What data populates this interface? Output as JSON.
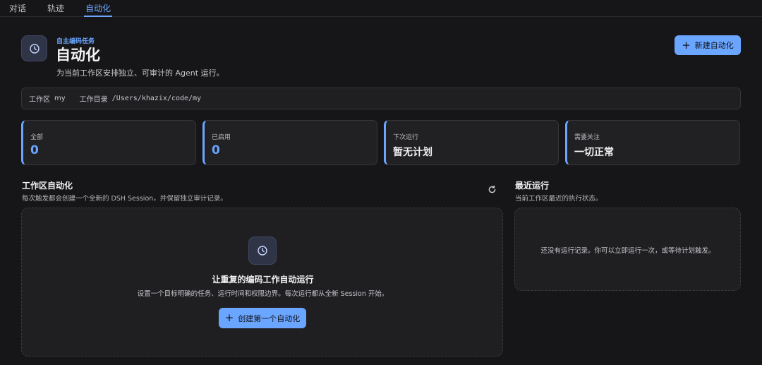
{
  "tabs": [
    {
      "label": "对话",
      "active": false
    },
    {
      "label": "轨迹",
      "active": false
    },
    {
      "label": "自动化",
      "active": true
    }
  ],
  "header": {
    "icon": "clock-icon",
    "eyebrow": "自主编码任务",
    "title": "自动化",
    "subtitle": "为当前工作区安排独立、可审计的 Agent 运行。",
    "new_button": "新建自动化"
  },
  "pathbar": {
    "workspace_label": "工作区",
    "workspace_value": "my",
    "dir_label": "工作目录",
    "dir_value": "/Users/khazix/code/my"
  },
  "stats": [
    {
      "label": "全部",
      "value": "0"
    },
    {
      "label": "已启用",
      "value": "0"
    },
    {
      "label": "下次运行",
      "value": "暂无计划"
    },
    {
      "label": "需要关注",
      "value": "一切正常"
    }
  ],
  "automations": {
    "title": "工作区自动化",
    "subtitle": "每次触发都会创建一个全新的 DSH Session，并保留独立审计记录。",
    "empty_title": "让重复的编码工作自动运行",
    "empty_desc": "设置一个目标明确的任务、运行时间和权限边界。每次运行都从全新 Session 开始。",
    "create_button": "创建第一个自动化"
  },
  "recent": {
    "title": "最近运行",
    "subtitle": "当前工作区最近的执行状态。",
    "empty": "还没有运行记录。你可以立即运行一次，或等待计划触发。"
  },
  "colors": {
    "accent": "#6aa5ff",
    "background": "#161618",
    "card": "#212124"
  }
}
